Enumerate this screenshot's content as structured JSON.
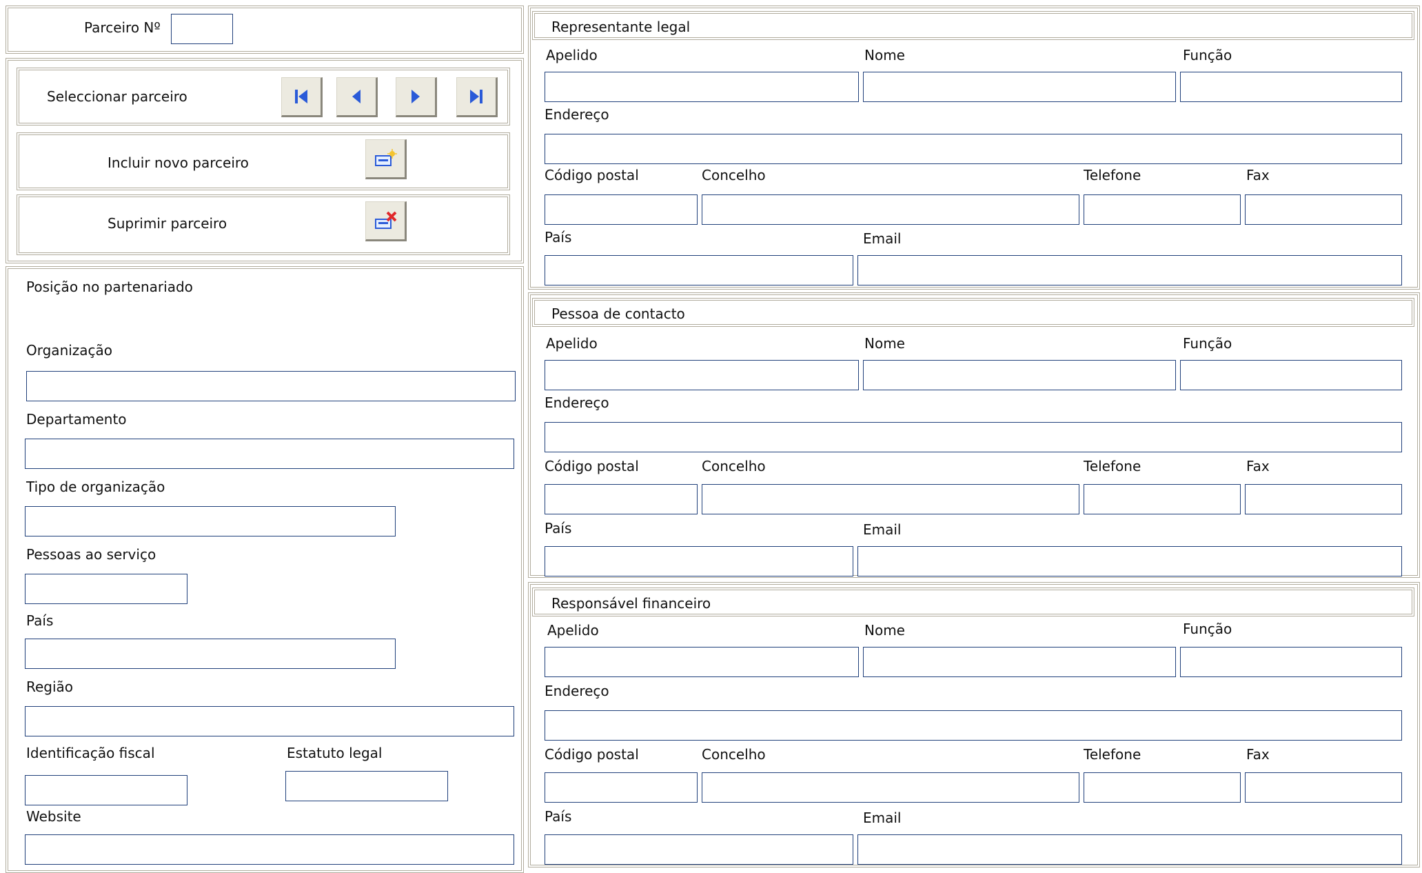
{
  "header": {
    "partner_no_label": "Parceiro Nº",
    "partner_no_value": ""
  },
  "navigation": {
    "select_partner_label": "Seleccionar parceiro",
    "first_icon": "first-record-icon",
    "prev_icon": "previous-record-icon",
    "next_icon": "next-record-icon",
    "last_icon": "last-record-icon"
  },
  "actions": {
    "add_label": "Incluir novo parceiro",
    "add_icon": "add-record-icon",
    "delete_label": "Suprimir parceiro",
    "delete_icon": "delete-record-icon"
  },
  "organization": {
    "position_label": "Posição no partenariado",
    "org_label": "Organização",
    "org_value": "",
    "dept_label": "Departamento",
    "dept_value": "",
    "type_label": "Tipo de organização",
    "type_value": "",
    "staff_label": "Pessoas ao serviço",
    "staff_value": "",
    "country_label": "País",
    "country_value": "",
    "region_label": "Região",
    "region_value": "",
    "taxid_label": "Identificação fiscal",
    "taxid_value": "",
    "legal_label": "Estatuto legal",
    "legal_value": "",
    "website_label": "Website",
    "website_value": ""
  },
  "labels": {
    "surname": "Apelido",
    "name": "Nome",
    "function": "Função",
    "address": "Endereço",
    "postal_code": "Código postal",
    "municipality": "Concelho",
    "phone": "Telefone",
    "fax": "Fax",
    "country": "País",
    "email": "Email"
  },
  "sections": [
    {
      "title": "Representante legal",
      "values": {
        "surname": "",
        "name": "",
        "function": "",
        "address": "",
        "postal_code": "",
        "municipality": "",
        "phone": "",
        "fax": "",
        "country": "",
        "email": ""
      }
    },
    {
      "title": "Pessoa de contacto",
      "values": {
        "surname": "",
        "name": "",
        "function": "",
        "address": "",
        "postal_code": "",
        "municipality": "",
        "phone": "",
        "fax": "",
        "country": "",
        "email": ""
      }
    },
    {
      "title": "Responsável financeiro",
      "values": {
        "surname": "",
        "name": "",
        "function": "",
        "address": "",
        "postal_code": "",
        "municipality": "",
        "phone": "",
        "fax": "",
        "country": "",
        "email": ""
      }
    }
  ],
  "colors": {
    "field_border": "#1f3f7a",
    "panel_border": "#b0ab9c",
    "nav_icon": "#2a5ad8",
    "delete_icon": "#e0282a"
  }
}
